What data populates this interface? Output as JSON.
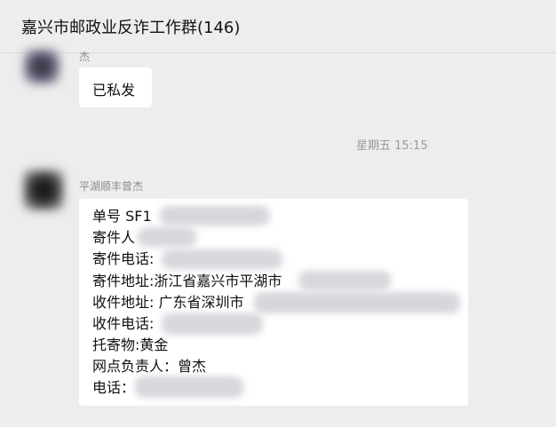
{
  "header": {
    "title": "嘉兴市邮政业反诈工作群(146)"
  },
  "messages": [
    {
      "sender": "杰",
      "text": "已私发"
    },
    {
      "timestamp": "星期五 15:15"
    },
    {
      "sender": "平湖顺丰曾杰",
      "lines": [
        "单号  SF1",
        "寄件人",
        "寄件电话:",
        "寄件地址:浙江省嘉兴市平湖市",
        "收件地址: 广东省深圳市",
        "收件电话:",
        "托寄物:黄金",
        "网点负责人：曾杰",
        "电话："
      ]
    }
  ]
}
